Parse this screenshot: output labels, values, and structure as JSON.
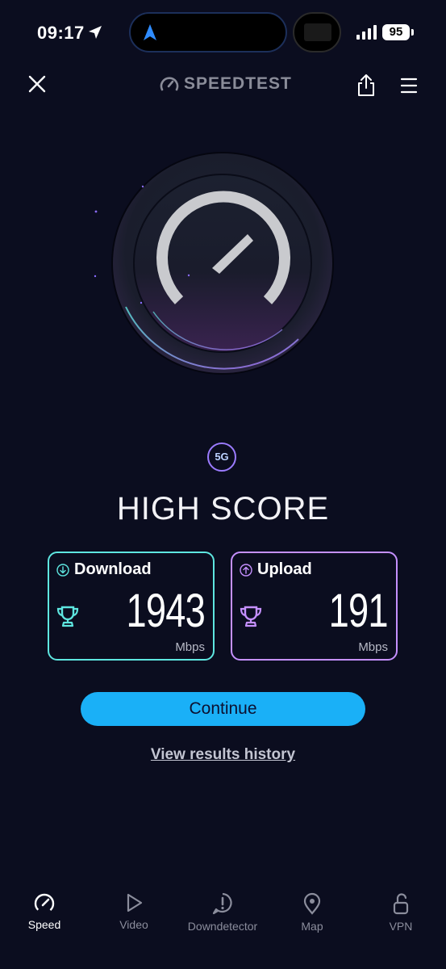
{
  "status_bar": {
    "time": "09:17",
    "battery": "95"
  },
  "header": {
    "brand": "SPEEDTEST"
  },
  "network": {
    "badge": "5G"
  },
  "result": {
    "title": "HIGH SCORE",
    "download": {
      "label": "Download",
      "value": "1943",
      "unit": "Mbps"
    },
    "upload": {
      "label": "Upload",
      "value": "191",
      "unit": "Mbps"
    }
  },
  "actions": {
    "continue_label": "Continue",
    "history_label": "View results history"
  },
  "tabs": [
    {
      "label": "Speed",
      "icon": "speedometer-icon",
      "active": true
    },
    {
      "label": "Video",
      "icon": "play-icon",
      "active": false
    },
    {
      "label": "Downdetector",
      "icon": "alert-icon",
      "active": false
    },
    {
      "label": "Map",
      "icon": "map-pin-icon",
      "active": false
    },
    {
      "label": "VPN",
      "icon": "unlock-icon",
      "active": false
    }
  ],
  "colors": {
    "background": "#0b0d1f",
    "download_accent": "#5ee6e0",
    "upload_accent": "#c590ff",
    "button": "#1ab0f7"
  }
}
